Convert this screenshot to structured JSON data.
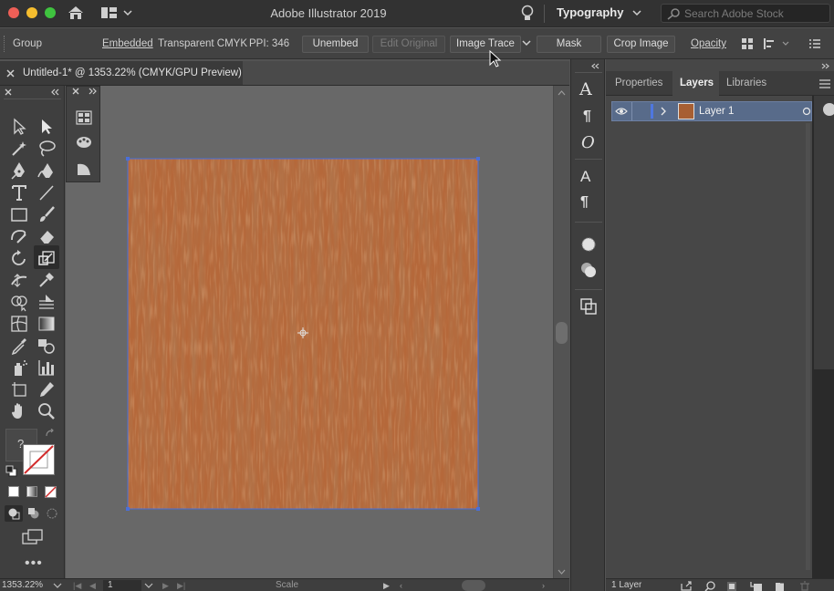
{
  "app": {
    "title": "Adobe Illustrator 2019",
    "workspace": "Typography",
    "search_placeholder": "Search Adobe Stock"
  },
  "control_bar": {
    "selection_type": "Group",
    "embedded": "Embedded",
    "color_mode": "Transparent CMYK",
    "ppi": "PPI: 346",
    "unembed": "Unembed",
    "edit_original": "Edit Original",
    "image_trace": "Image Trace",
    "mask": "Mask",
    "crop_image": "Crop Image",
    "opacity": "Opacity"
  },
  "document": {
    "tab_title": "Untitled-1* @ 1353.22% (CMYK/GPU Preview)",
    "zoom": "1353.22%",
    "artboard_number": "1",
    "status": "Scale"
  },
  "panels": {
    "tabs": [
      "Properties",
      "Layers",
      "Libraries"
    ],
    "active_tab": "Layers",
    "layer_name": "Layer 1",
    "layer_count": "1 Layer"
  },
  "colors": {
    "wood": "#b5683a",
    "selection": "#4a6fd8",
    "accent": "#586b8a"
  }
}
